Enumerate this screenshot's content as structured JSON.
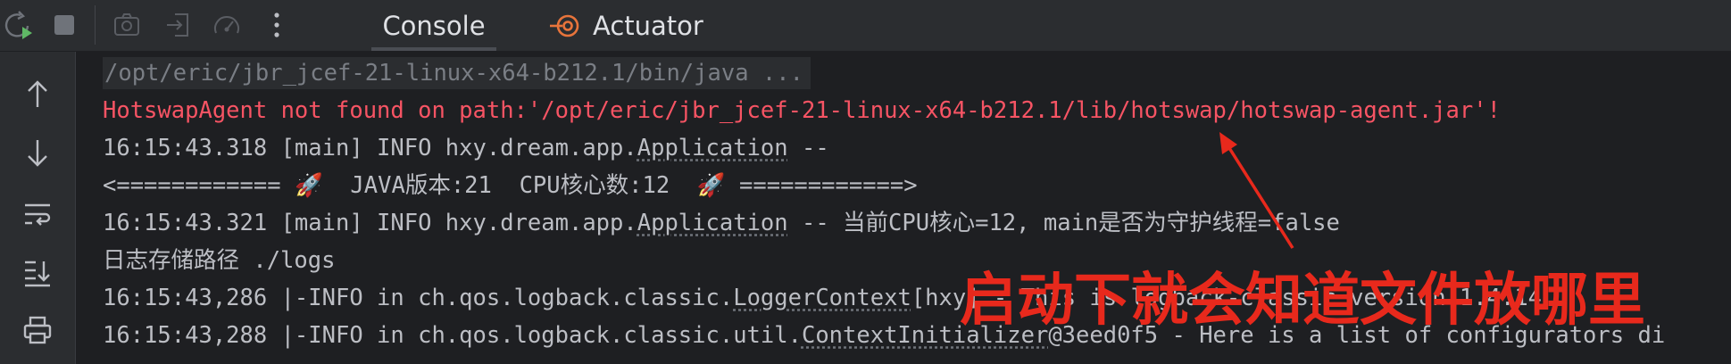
{
  "toolbar": {
    "icons": [
      "rerun-icon",
      "stop-icon",
      "screenshot-icon",
      "restore-layout-icon",
      "gauge-icon",
      "more-icon"
    ],
    "tabs": [
      {
        "label": "Console",
        "active": true
      },
      {
        "label": "Actuator",
        "active": false
      }
    ]
  },
  "sidebar": {
    "icons": [
      "arrow-up-icon",
      "arrow-down-icon",
      "soft-wrap-icon",
      "scroll-to-end-icon",
      "print-icon"
    ]
  },
  "console": {
    "line1": "/opt/eric/jbr_jcef-21-linux-x64-b212.1/bin/java ...",
    "line2": "HotswapAgent not found on path:'/opt/eric/jbr_jcef-21-linux-x64-b212.1/lib/hotswap/hotswap-agent.jar'!",
    "line3": {
      "prefix": "16:15:43.318 [main] INFO hxy.dream.app.",
      "link": "Application",
      "suffix": " --"
    },
    "line4": {
      "a": "<============ ",
      "rocket": "🚀",
      "b": "  JAVA版本:21  CPU核心数:12  ",
      "c": " ============>"
    },
    "line5": {
      "prefix": "16:15:43.321 [main] INFO hxy.dream.app.",
      "link": "Application",
      "suffix": " -- 当前CPU核心=12, main是否为守护线程=false"
    },
    "line6": "日志存储路径 ./logs",
    "line7": {
      "prefix": "16:15:43,286 |-INFO in ch.qos.logback.classic.",
      "link": "LoggerContext",
      "suffix": "[hxy] - This is logback-classic version 1.4.14"
    },
    "line8": {
      "prefix": "16:15:43,288 |-INFO in ch.qos.logback.classic.util.",
      "link": "ContextInitializer",
      "suffix": "@3eed0f5 - Here is a list of configurators di"
    }
  },
  "annotation": {
    "text": "启动下就会知道文件放哪里",
    "color": "#e8291c"
  },
  "colors": {
    "error": "#f75464",
    "background": "#1e1f22",
    "panel": "#2b2d30",
    "annotation": "#e8291c"
  }
}
